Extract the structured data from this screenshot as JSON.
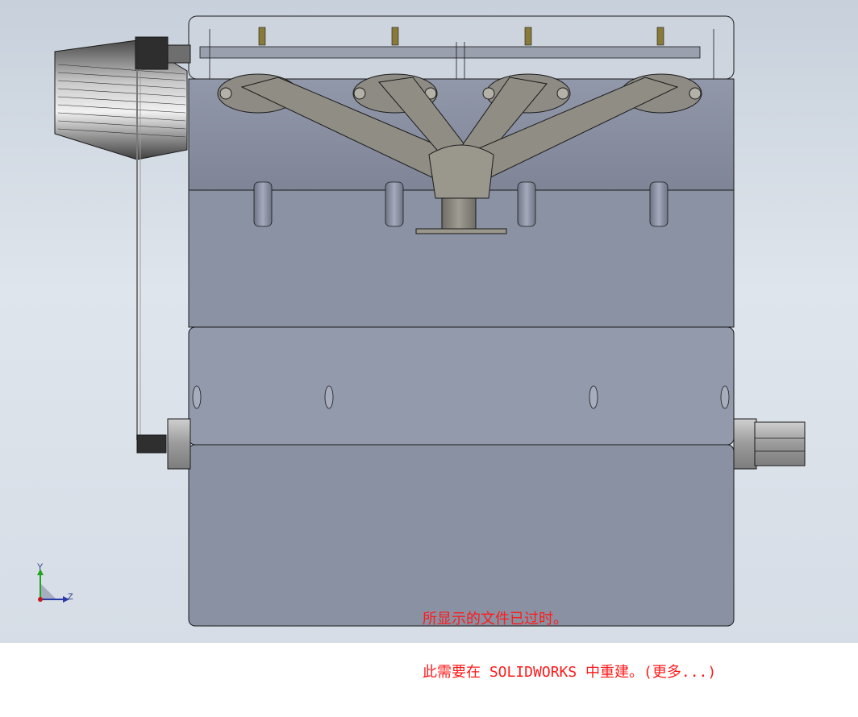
{
  "viewport": {
    "model": "engine-assembly-front-view",
    "rebuild_warning": {
      "line1": "所显示的文件已过时。",
      "line2": "此需要在 SOLIDWORKS 中重建。(更多...)"
    },
    "triad": {
      "y_label": "Y",
      "z_label": "Z"
    }
  },
  "colors": {
    "background_top": "#c7d0db",
    "block": "#8b92a4",
    "manifold": "#8a887f",
    "warning": "#ff1a1a"
  },
  "icons": [
    "air-filter-icon",
    "exhaust-manifold-icon",
    "spark-plug-icon",
    "pulley-icon",
    "coordinate-triad-icon"
  ]
}
